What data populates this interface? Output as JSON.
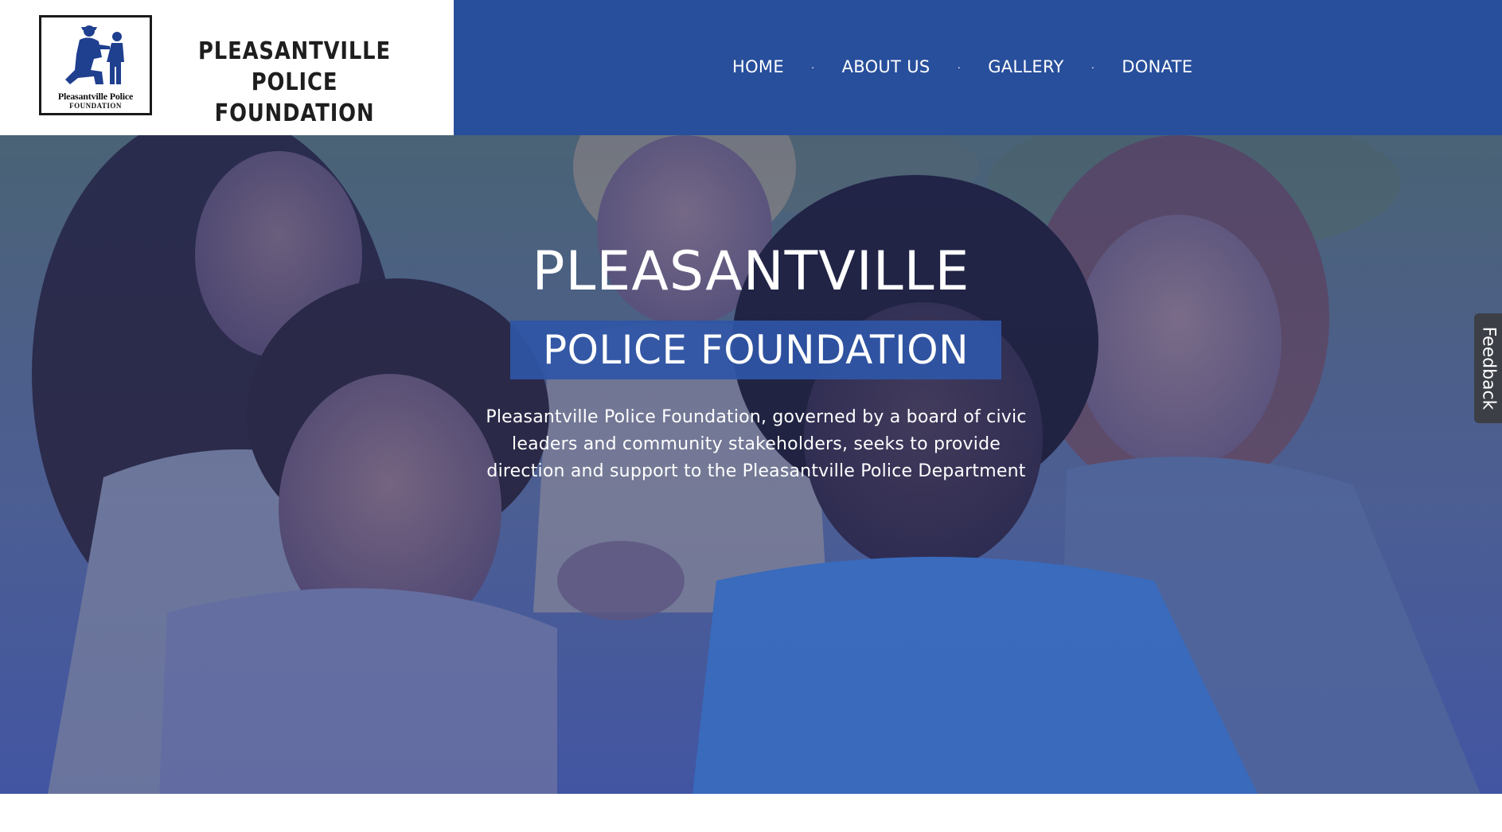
{
  "brand": {
    "logo_caption_line1": "Pleasantville Police",
    "logo_caption_line2": "FOUNDATION",
    "title_line1": "PLEASANTVILLE POLICE",
    "title_line2": "FOUNDATION"
  },
  "nav": {
    "items": [
      {
        "label": "HOME"
      },
      {
        "label": "ABOUT US"
      },
      {
        "label": "GALLERY"
      },
      {
        "label": "DONATE"
      }
    ],
    "separator": "·"
  },
  "hero": {
    "title": "PLEASANTVILLE",
    "subtitle": "POLICE FOUNDATION",
    "description": "Pleasantville Police Foundation, governed by a board of civic leaders and community stakeholders, seeks to provide direction and support to the Pleasantville Police Department",
    "image": "smiling-children-photo"
  },
  "feedback": {
    "label": "Feedback"
  },
  "colors": {
    "nav_background": "#284f9c",
    "subtitle_highlight": "#2f56a6",
    "feedback_tab": "#3c3f46"
  }
}
